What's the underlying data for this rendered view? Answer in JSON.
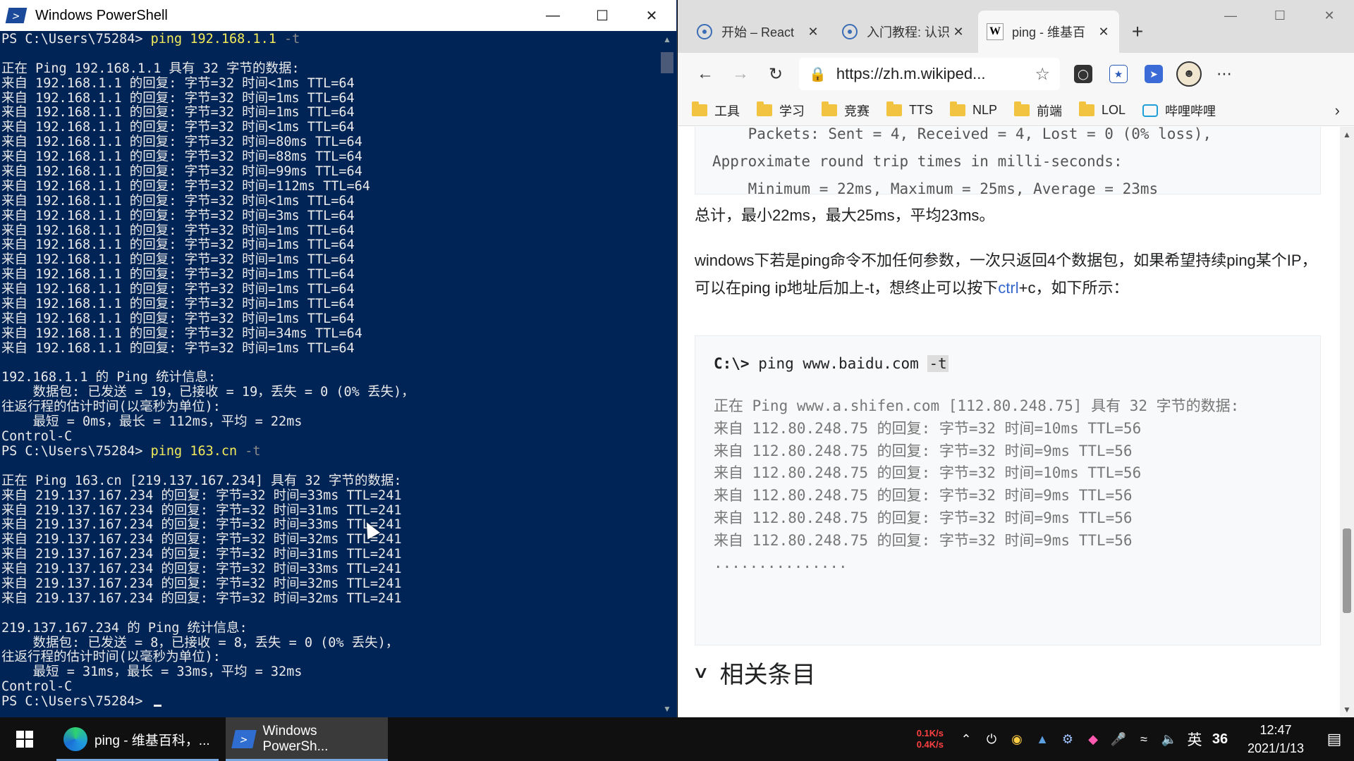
{
  "powershell": {
    "title": "Windows PowerShell",
    "lines": [
      {
        "prompt": "PS C:\\Users\\75284> ",
        "cmd": "ping",
        "args": " 192.168.1.1 ",
        "opt": "-t"
      },
      {
        "text": ""
      },
      {
        "text": "正在 Ping 192.168.1.1 具有 32 字节的数据:"
      },
      {
        "text": "来自 192.168.1.1 的回复: 字节=32 时间<1ms TTL=64"
      },
      {
        "text": "来自 192.168.1.1 的回复: 字节=32 时间=1ms TTL=64"
      },
      {
        "text": "来自 192.168.1.1 的回复: 字节=32 时间=1ms TTL=64"
      },
      {
        "text": "来自 192.168.1.1 的回复: 字节=32 时间<1ms TTL=64"
      },
      {
        "text": "来自 192.168.1.1 的回复: 字节=32 时间=80ms TTL=64"
      },
      {
        "text": "来自 192.168.1.1 的回复: 字节=32 时间=88ms TTL=64"
      },
      {
        "text": "来自 192.168.1.1 的回复: 字节=32 时间=99ms TTL=64"
      },
      {
        "text": "来自 192.168.1.1 的回复: 字节=32 时间=112ms TTL=64"
      },
      {
        "text": "来自 192.168.1.1 的回复: 字节=32 时间<1ms TTL=64"
      },
      {
        "text": "来自 192.168.1.1 的回复: 字节=32 时间=3ms TTL=64"
      },
      {
        "text": "来自 192.168.1.1 的回复: 字节=32 时间=1ms TTL=64"
      },
      {
        "text": "来自 192.168.1.1 的回复: 字节=32 时间=1ms TTL=64"
      },
      {
        "text": "来自 192.168.1.1 的回复: 字节=32 时间=1ms TTL=64"
      },
      {
        "text": "来自 192.168.1.1 的回复: 字节=32 时间=1ms TTL=64"
      },
      {
        "text": "来自 192.168.1.1 的回复: 字节=32 时间=1ms TTL=64"
      },
      {
        "text": "来自 192.168.1.1 的回复: 字节=32 时间=1ms TTL=64"
      },
      {
        "text": "来自 192.168.1.1 的回复: 字节=32 时间=1ms TTL=64"
      },
      {
        "text": "来自 192.168.1.1 的回复: 字节=32 时间=34ms TTL=64"
      },
      {
        "text": "来自 192.168.1.1 的回复: 字节=32 时间=1ms TTL=64"
      },
      {
        "text": ""
      },
      {
        "text": "192.168.1.1 的 Ping 统计信息:"
      },
      {
        "text": "    数据包: 已发送 = 19，已接收 = 19，丢失 = 0 (0% 丢失)，"
      },
      {
        "text": "往返行程的估计时间(以毫秒为单位):"
      },
      {
        "text": "    最短 = 0ms，最长 = 112ms，平均 = 22ms"
      },
      {
        "text": "Control-C"
      },
      {
        "prompt": "PS C:\\Users\\75284> ",
        "cmd": "ping",
        "args": " 163.cn ",
        "opt": "-t"
      },
      {
        "text": ""
      },
      {
        "text": "正在 Ping 163.cn [219.137.167.234] 具有 32 字节的数据:"
      },
      {
        "text": "来自 219.137.167.234 的回复: 字节=32 时间=33ms TTL=241"
      },
      {
        "text": "来自 219.137.167.234 的回复: 字节=32 时间=31ms TTL=241"
      },
      {
        "text": "来自 219.137.167.234 的回复: 字节=32 时间=33ms TTL=241"
      },
      {
        "text": "来自 219.137.167.234 的回复: 字节=32 时间=32ms TTL=241"
      },
      {
        "text": "来自 219.137.167.234 的回复: 字节=32 时间=31ms TTL=241"
      },
      {
        "text": "来自 219.137.167.234 的回复: 字节=32 时间=33ms TTL=241"
      },
      {
        "text": "来自 219.137.167.234 的回复: 字节=32 时间=32ms TTL=241"
      },
      {
        "text": "来自 219.137.167.234 的回复: 字节=32 时间=32ms TTL=241"
      },
      {
        "text": ""
      },
      {
        "text": "219.137.167.234 的 Ping 统计信息:"
      },
      {
        "text": "    数据包: 已发送 = 8，已接收 = 8，丢失 = 0 (0% 丢失)，"
      },
      {
        "text": "往返行程的估计时间(以毫秒为单位):"
      },
      {
        "text": "    最短 = 31ms，最长 = 33ms，平均 = 32ms"
      },
      {
        "text": "Control-C"
      },
      {
        "prompt": "PS C:\\Users\\75284> ",
        "cmd": "",
        "args": "",
        "opt": "",
        "cursor": true
      }
    ],
    "colors": {
      "background": "#012456",
      "command": "#f3ec5a",
      "text": "#eaeaea"
    }
  },
  "browser": {
    "tabs": [
      {
        "label": "开始 – React",
        "icon": "react-icon",
        "active": false
      },
      {
        "label": "入门教程: 认识",
        "icon": "react-icon",
        "active": false
      },
      {
        "label": "ping - 维基百",
        "icon": "wikipedia-icon",
        "active": true
      }
    ],
    "new_tab": "+",
    "url": "https://zh.m.wikiped...",
    "bookmarks": [
      {
        "label": "工具",
        "icon": "folder-icon"
      },
      {
        "label": "学习",
        "icon": "folder-icon"
      },
      {
        "label": "竞赛",
        "icon": "folder-icon"
      },
      {
        "label": "TTS",
        "icon": "folder-icon"
      },
      {
        "label": "NLP",
        "icon": "folder-icon"
      },
      {
        "label": "前端",
        "icon": "folder-icon"
      },
      {
        "label": "LOL",
        "icon": "folder-icon"
      },
      {
        "label": "哔哩哔哩",
        "icon": "bilibili-icon"
      }
    ],
    "page": {
      "box1": [
        "    Packets: Sent = 4, Received = 4, Lost = 0 (0% loss),",
        "Approximate round trip times in milli-seconds:",
        "    Minimum = 22ms, Maximum = 25ms, Average = 23ms"
      ],
      "summary": "总计，最小22ms，最大25ms，平均23ms。",
      "para_before_link": "windows下若是ping命令不加任何参数，一次只返回4个数据包，如果希望持续ping某个IP，可以在ping ip地址后加上-t，想终止可以按下",
      "para_link": "ctrl",
      "para_after_link": "+c，如下所示：",
      "code_prompt": "C:\\>",
      "code_cmd": " ping www.baidu.com ",
      "code_opt": "-t",
      "box2": [
        "正在 Ping www.a.shifen.com [112.80.248.75] 具有 32 字节的数据:",
        "来自 112.80.248.75 的回复: 字节=32 时间=10ms TTL=56",
        "来自 112.80.248.75 的回复: 字节=32 时间=9ms TTL=56",
        "来自 112.80.248.75 的回复: 字节=32 时间=10ms TTL=56",
        "来自 112.80.248.75 的回复: 字节=32 时间=9ms TTL=56",
        "来自 112.80.248.75 的回复: 字节=32 时间=9ms TTL=56",
        "来自 112.80.248.75 的回复: 字节=32 时间=9ms TTL=56",
        "..............."
      ],
      "related_heading": "相关条目"
    }
  },
  "taskbar": {
    "tasks": [
      {
        "label": "ping - 维基百科，...",
        "icon": "edge-icon",
        "active": false
      },
      {
        "label": "Windows PowerSh...",
        "icon": "powershell-icon",
        "active": true
      }
    ],
    "net_up": "0.1K/s",
    "net_down": "0.4K/s",
    "ime": "英",
    "badge": "36",
    "time": "12:47",
    "date": "2021/1/13"
  }
}
